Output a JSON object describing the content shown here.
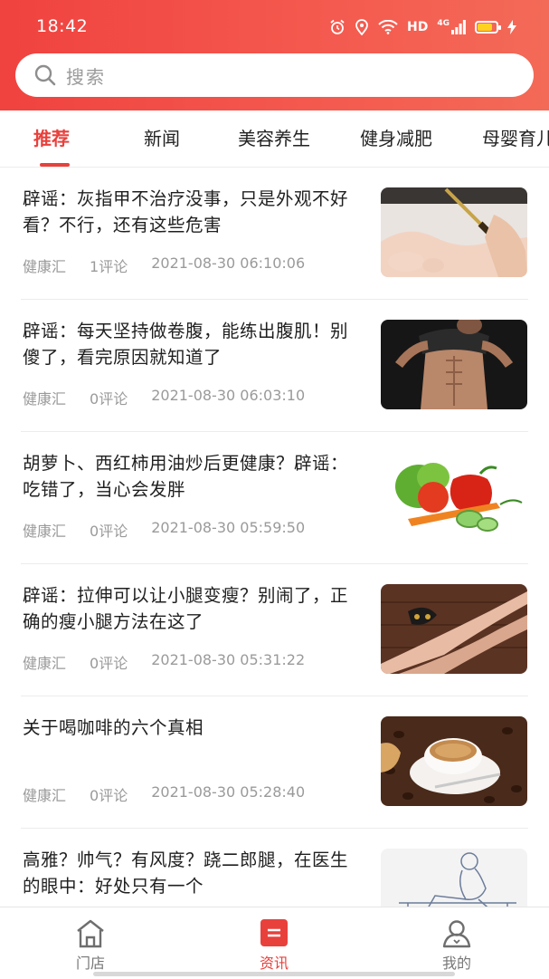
{
  "status_bar": {
    "time": "18:42",
    "network_label": "HD",
    "network_type": "4G",
    "icons": [
      "alarm-icon",
      "location-icon",
      "wifi-icon",
      "hd-icon",
      "signal-icon",
      "battery-icon",
      "charging-icon"
    ]
  },
  "search": {
    "placeholder": "搜索"
  },
  "tabs": [
    {
      "label": "推荐",
      "active": true
    },
    {
      "label": "新闻"
    },
    {
      "label": "美容养生"
    },
    {
      "label": "健身减肥"
    },
    {
      "label": "母婴育儿"
    }
  ],
  "articles": [
    {
      "title": "辟谣：灰指甲不治疗没事，只是外观不好看？不行，还有这些危害",
      "source": "健康汇",
      "comments": "1评论",
      "time": "2021-08-30 06:10:06",
      "image": "foot-treatment"
    },
    {
      "title": "辟谣：每天坚持做卷腹，能练出腹肌！别傻了，看完原因就知道了",
      "source": "健康汇",
      "comments": "0评论",
      "time": "2021-08-30 06:03:10",
      "image": "abs-man"
    },
    {
      "title": "胡萝卜、西红柿用油炒后更健康？辟谣：吃错了，当心会发胖",
      "source": "健康汇",
      "comments": "0评论",
      "time": "2021-08-30 05:59:50",
      "image": "vegetables"
    },
    {
      "title": "辟谣：拉伸可以让小腿变瘦？别闹了，正确的瘦小腿方法在这了",
      "source": "健康汇",
      "comments": "0评论",
      "time": "2021-08-30 05:31:22",
      "image": "legs"
    },
    {
      "title": "关于喝咖啡的六个真相",
      "source": "健康汇",
      "comments": "0评论",
      "time": "2021-08-30 05:28:40",
      "image": "coffee"
    },
    {
      "title": "高雅？帅气？有风度？跷二郎腿，在医生的眼中：好处只有一个",
      "source": "",
      "comments": "",
      "time": "",
      "image": "sketch"
    }
  ],
  "bottom_nav": [
    {
      "label": "门店",
      "icon": "store-icon"
    },
    {
      "label": "资讯",
      "icon": "news-icon",
      "active": true
    },
    {
      "label": "我的",
      "icon": "profile-icon"
    }
  ],
  "colors": {
    "accent": "#e8413c",
    "header_start": "#f0423f",
    "header_end": "#f36a57"
  }
}
